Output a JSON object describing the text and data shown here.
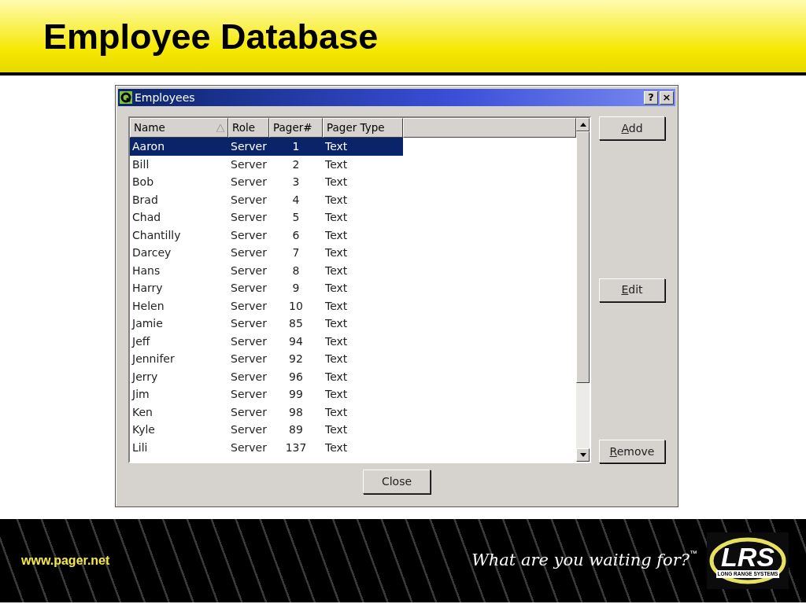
{
  "slide_title": "Employee Database",
  "window": {
    "title": "Employees",
    "title_buttons": [
      "?",
      "×"
    ]
  },
  "table": {
    "columns": [
      {
        "label": "Name",
        "sorted": true
      },
      {
        "label": "Role",
        "sorted": false
      },
      {
        "label": "Pager#",
        "sorted": false
      },
      {
        "label": "Pager Type",
        "sorted": false
      }
    ],
    "rows": [
      {
        "cells": [
          "Aaron",
          "Server",
          "1",
          "Text"
        ],
        "selected": true
      },
      {
        "cells": [
          "Bill",
          "Server",
          "2",
          "Text"
        ],
        "selected": false
      },
      {
        "cells": [
          "Bob",
          "Server",
          "3",
          "Text"
        ],
        "selected": false
      },
      {
        "cells": [
          "Brad",
          "Server",
          "4",
          "Text"
        ],
        "selected": false
      },
      {
        "cells": [
          "Chad",
          "Server",
          "5",
          "Text"
        ],
        "selected": false
      },
      {
        "cells": [
          "Chantilly",
          "Server",
          "6",
          "Text"
        ],
        "selected": false
      },
      {
        "cells": [
          "Darcey",
          "Server",
          "7",
          "Text"
        ],
        "selected": false
      },
      {
        "cells": [
          "Hans",
          "Server",
          "8",
          "Text"
        ],
        "selected": false
      },
      {
        "cells": [
          "Harry",
          "Server",
          "9",
          "Text"
        ],
        "selected": false
      },
      {
        "cells": [
          "Helen",
          "Server",
          "10",
          "Text"
        ],
        "selected": false
      },
      {
        "cells": [
          "Jamie",
          "Server",
          "85",
          "Text"
        ],
        "selected": false
      },
      {
        "cells": [
          "Jeff",
          "Server",
          "94",
          "Text"
        ],
        "selected": false
      },
      {
        "cells": [
          "Jennifer",
          "Server",
          "92",
          "Text"
        ],
        "selected": false
      },
      {
        "cells": [
          "Jerry",
          "Server",
          "96",
          "Text"
        ],
        "selected": false
      },
      {
        "cells": [
          "Jim",
          "Server",
          "99",
          "Text"
        ],
        "selected": false
      },
      {
        "cells": [
          "Ken",
          "Server",
          "98",
          "Text"
        ],
        "selected": false
      },
      {
        "cells": [
          "Kyle",
          "Server",
          "89",
          "Text"
        ],
        "selected": false
      },
      {
        "cells": [
          "Lili",
          "Server",
          "137",
          "Text"
        ],
        "selected": false
      }
    ]
  },
  "side_buttons": [
    {
      "key": "A",
      "rest": "dd"
    },
    {
      "key": "E",
      "rest": "dit"
    },
    {
      "key": "R",
      "rest": "emove"
    }
  ],
  "close_button": "Close",
  "footer": {
    "url": "www.pager.net",
    "tagline": "What are you waiting for?",
    "trademark": "™",
    "logo_text": "LRS",
    "logo_subtext": "LONG RANGE SYSTEMS"
  }
}
